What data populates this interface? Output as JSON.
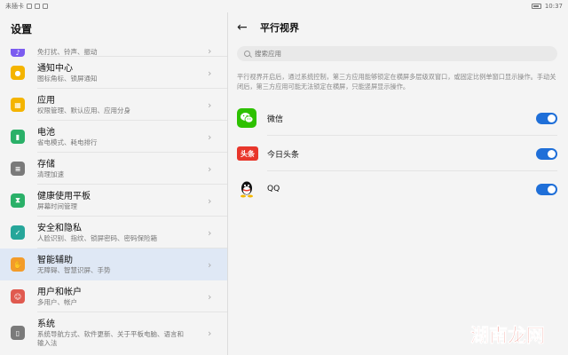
{
  "status": {
    "carrier": "未插卡",
    "time": "10:37"
  },
  "left": {
    "title": "设置",
    "items": [
      {
        "title": "",
        "sub": "免打扰、铃声、振动",
        "color": "#7b5cf0",
        "icon": "sound-icon",
        "glyph": "♪"
      },
      {
        "title": "通知中心",
        "sub": "图标角标、锁屏通知",
        "color": "#f4b400",
        "icon": "bell-icon",
        "glyph": "●"
      },
      {
        "title": "应用",
        "sub": "权限管理、默认应用、应用分身",
        "color": "#f4b400",
        "icon": "apps-icon",
        "glyph": "▦"
      },
      {
        "title": "电池",
        "sub": "省电模式、耗电排行",
        "color": "#2ab068",
        "icon": "battery-icon",
        "glyph": "▮"
      },
      {
        "title": "存储",
        "sub": "清理加速",
        "color": "#7a7a7a",
        "icon": "storage-icon",
        "glyph": "≡"
      },
      {
        "title": "健康使用平板",
        "sub": "屏幕时间管理",
        "color": "#2ab068",
        "icon": "hourglass-icon",
        "glyph": "⧗"
      },
      {
        "title": "安全和隐私",
        "sub": "人脸识别、指纹、锁屏密码、密码保险箱",
        "color": "#26a69a",
        "icon": "shield-icon",
        "glyph": "✓"
      },
      {
        "title": "智能辅助",
        "sub": "无障碍、智慧识屏、手势",
        "color": "#f39c2a",
        "icon": "hand-icon",
        "glyph": "✋"
      },
      {
        "title": "用户和帐户",
        "sub": "多用户、帐户",
        "color": "#e05a4f",
        "icon": "user-icon",
        "glyph": "☺"
      },
      {
        "title": "系统",
        "sub": "系统导航方式、软件更新、关于平板电脑、语言和",
        "sub2": "输入法",
        "color": "#7a7a7a",
        "icon": "system-icon",
        "glyph": "▯"
      }
    ]
  },
  "right": {
    "title": "平行视界",
    "search_placeholder": "搜索应用",
    "description": "平行视界开启后，通过系统控制，第三方应用能够锁定在横屏多层级双窗口，或固定比例单窗口显示操作。手动关闭后，第三方应用可能无法锁定在横屏，只能竖屏显示操作。",
    "apps": [
      {
        "name": "微信",
        "enabled": true,
        "icon": "wechat-icon"
      },
      {
        "name": "今日头条",
        "enabled": true,
        "icon": "toutiao-icon",
        "badge": "头条"
      },
      {
        "name": "QQ",
        "enabled": true,
        "icon": "qq-icon"
      }
    ]
  },
  "watermark": "湖南龙网",
  "colors": {
    "accent": "#1f6fd8",
    "active_bg": "#dfe8f5",
    "watermark": "#e03a2a"
  }
}
